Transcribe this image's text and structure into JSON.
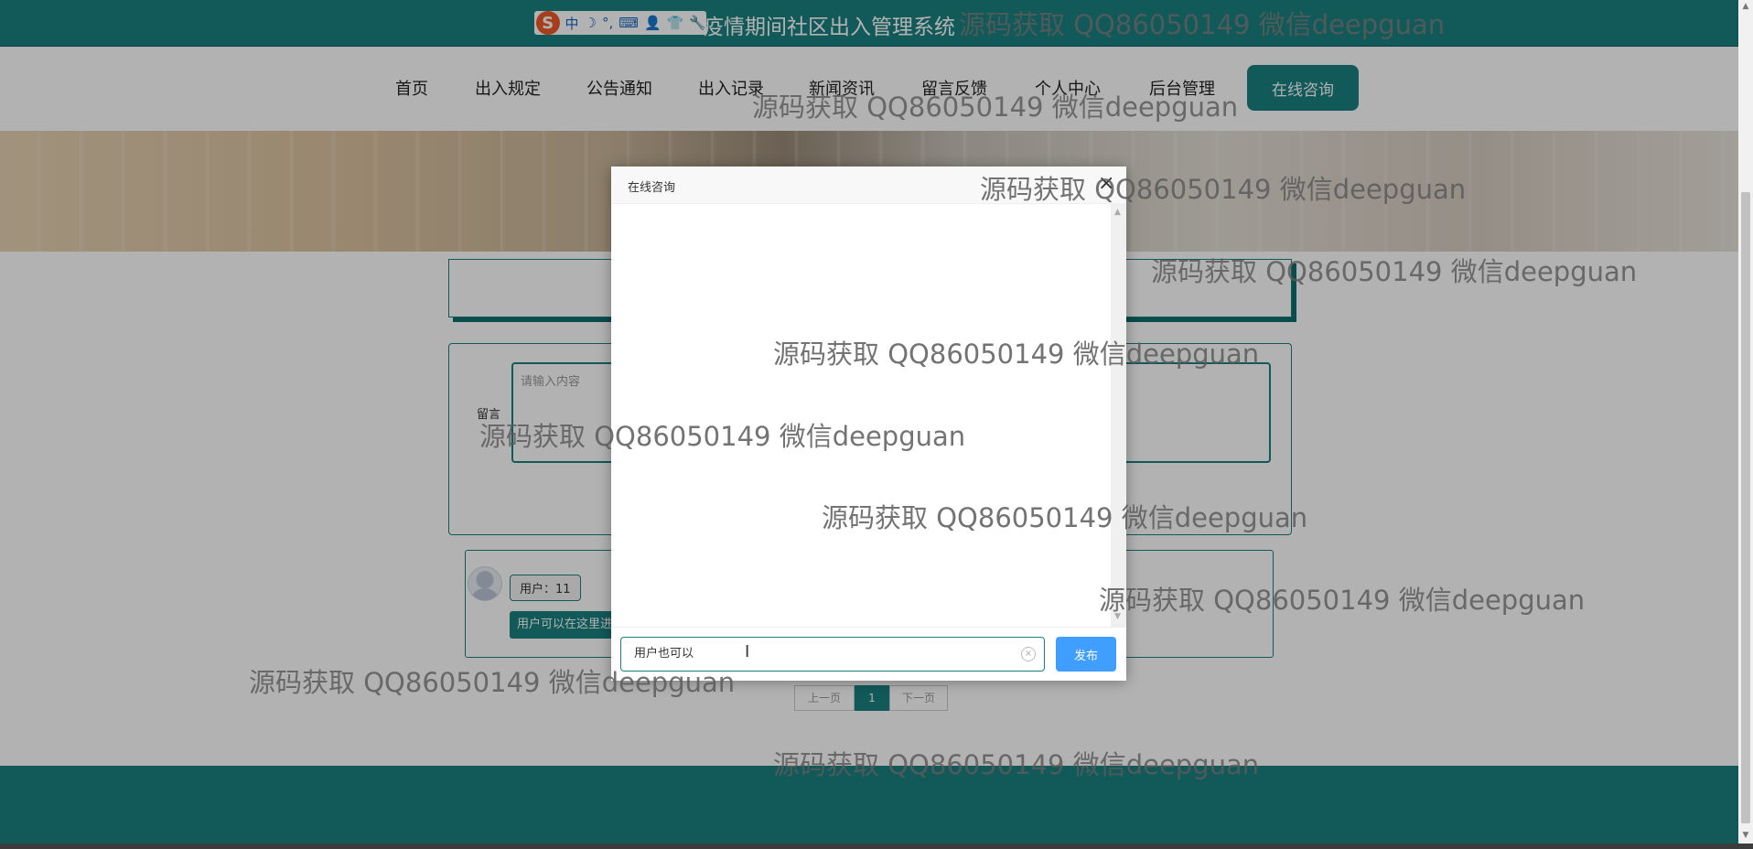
{
  "header": {
    "site_title": "疫情期间社区出入管理系统",
    "ime_toolbar": {
      "logo": "S",
      "items": [
        "中",
        "☽",
        "°,",
        "⌨",
        "👤",
        "👕",
        "🔧"
      ]
    }
  },
  "nav": {
    "items": [
      "首页",
      "出入规定",
      "公告通知",
      "出入记录",
      "新闻资讯",
      "留言反馈",
      "个人中心",
      "后台管理"
    ],
    "consult_button": "在线咨询"
  },
  "form": {
    "label": "留言",
    "placeholder": "请输入内容"
  },
  "message": {
    "user": "用户：11",
    "content": "用户可以在这里进"
  },
  "pagination": {
    "prev": "上一页",
    "current": "1",
    "next": "下一页"
  },
  "modal": {
    "title": "在线咨询",
    "close": "×",
    "input_value": "用户也可以",
    "send_button": "发布"
  },
  "watermark_text": "源码获取 QQ86050149 微信deepguan",
  "colors": {
    "primary": "#1b8082",
    "send_button": "#409eff"
  }
}
